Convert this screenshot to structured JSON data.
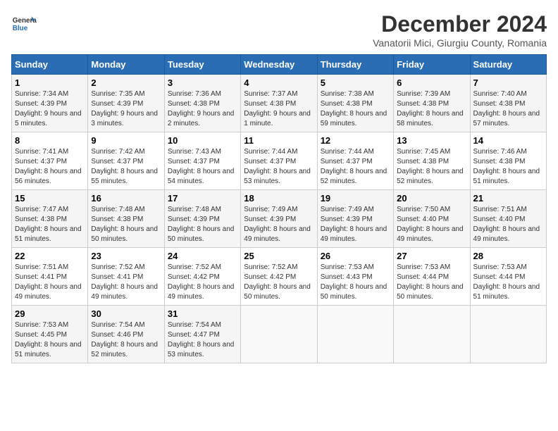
{
  "header": {
    "logo_line1": "General",
    "logo_line2": "Blue",
    "title": "December 2024",
    "subtitle": "Vanatorii Mici, Giurgiu County, Romania"
  },
  "weekdays": [
    "Sunday",
    "Monday",
    "Tuesday",
    "Wednesday",
    "Thursday",
    "Friday",
    "Saturday"
  ],
  "weeks": [
    [
      {
        "day": "1",
        "info": "Sunrise: 7:34 AM\nSunset: 4:39 PM\nDaylight: 9 hours and 5 minutes."
      },
      {
        "day": "2",
        "info": "Sunrise: 7:35 AM\nSunset: 4:39 PM\nDaylight: 9 hours and 3 minutes."
      },
      {
        "day": "3",
        "info": "Sunrise: 7:36 AM\nSunset: 4:38 PM\nDaylight: 9 hours and 2 minutes."
      },
      {
        "day": "4",
        "info": "Sunrise: 7:37 AM\nSunset: 4:38 PM\nDaylight: 9 hours and 1 minute."
      },
      {
        "day": "5",
        "info": "Sunrise: 7:38 AM\nSunset: 4:38 PM\nDaylight: 8 hours and 59 minutes."
      },
      {
        "day": "6",
        "info": "Sunrise: 7:39 AM\nSunset: 4:38 PM\nDaylight: 8 hours and 58 minutes."
      },
      {
        "day": "7",
        "info": "Sunrise: 7:40 AM\nSunset: 4:38 PM\nDaylight: 8 hours and 57 minutes."
      }
    ],
    [
      {
        "day": "8",
        "info": "Sunrise: 7:41 AM\nSunset: 4:37 PM\nDaylight: 8 hours and 56 minutes."
      },
      {
        "day": "9",
        "info": "Sunrise: 7:42 AM\nSunset: 4:37 PM\nDaylight: 8 hours and 55 minutes."
      },
      {
        "day": "10",
        "info": "Sunrise: 7:43 AM\nSunset: 4:37 PM\nDaylight: 8 hours and 54 minutes."
      },
      {
        "day": "11",
        "info": "Sunrise: 7:44 AM\nSunset: 4:37 PM\nDaylight: 8 hours and 53 minutes."
      },
      {
        "day": "12",
        "info": "Sunrise: 7:44 AM\nSunset: 4:37 PM\nDaylight: 8 hours and 52 minutes."
      },
      {
        "day": "13",
        "info": "Sunrise: 7:45 AM\nSunset: 4:38 PM\nDaylight: 8 hours and 52 minutes."
      },
      {
        "day": "14",
        "info": "Sunrise: 7:46 AM\nSunset: 4:38 PM\nDaylight: 8 hours and 51 minutes."
      }
    ],
    [
      {
        "day": "15",
        "info": "Sunrise: 7:47 AM\nSunset: 4:38 PM\nDaylight: 8 hours and 51 minutes."
      },
      {
        "day": "16",
        "info": "Sunrise: 7:48 AM\nSunset: 4:38 PM\nDaylight: 8 hours and 50 minutes."
      },
      {
        "day": "17",
        "info": "Sunrise: 7:48 AM\nSunset: 4:39 PM\nDaylight: 8 hours and 50 minutes."
      },
      {
        "day": "18",
        "info": "Sunrise: 7:49 AM\nSunset: 4:39 PM\nDaylight: 8 hours and 49 minutes."
      },
      {
        "day": "19",
        "info": "Sunrise: 7:49 AM\nSunset: 4:39 PM\nDaylight: 8 hours and 49 minutes."
      },
      {
        "day": "20",
        "info": "Sunrise: 7:50 AM\nSunset: 4:40 PM\nDaylight: 8 hours and 49 minutes."
      },
      {
        "day": "21",
        "info": "Sunrise: 7:51 AM\nSunset: 4:40 PM\nDaylight: 8 hours and 49 minutes."
      }
    ],
    [
      {
        "day": "22",
        "info": "Sunrise: 7:51 AM\nSunset: 4:41 PM\nDaylight: 8 hours and 49 minutes."
      },
      {
        "day": "23",
        "info": "Sunrise: 7:52 AM\nSunset: 4:41 PM\nDaylight: 8 hours and 49 minutes."
      },
      {
        "day": "24",
        "info": "Sunrise: 7:52 AM\nSunset: 4:42 PM\nDaylight: 8 hours and 49 minutes."
      },
      {
        "day": "25",
        "info": "Sunrise: 7:52 AM\nSunset: 4:42 PM\nDaylight: 8 hours and 50 minutes."
      },
      {
        "day": "26",
        "info": "Sunrise: 7:53 AM\nSunset: 4:43 PM\nDaylight: 8 hours and 50 minutes."
      },
      {
        "day": "27",
        "info": "Sunrise: 7:53 AM\nSunset: 4:44 PM\nDaylight: 8 hours and 50 minutes."
      },
      {
        "day": "28",
        "info": "Sunrise: 7:53 AM\nSunset: 4:44 PM\nDaylight: 8 hours and 51 minutes."
      }
    ],
    [
      {
        "day": "29",
        "info": "Sunrise: 7:53 AM\nSunset: 4:45 PM\nDaylight: 8 hours and 51 minutes."
      },
      {
        "day": "30",
        "info": "Sunrise: 7:54 AM\nSunset: 4:46 PM\nDaylight: 8 hours and 52 minutes."
      },
      {
        "day": "31",
        "info": "Sunrise: 7:54 AM\nSunset: 4:47 PM\nDaylight: 8 hours and 53 minutes."
      },
      null,
      null,
      null,
      null
    ]
  ]
}
